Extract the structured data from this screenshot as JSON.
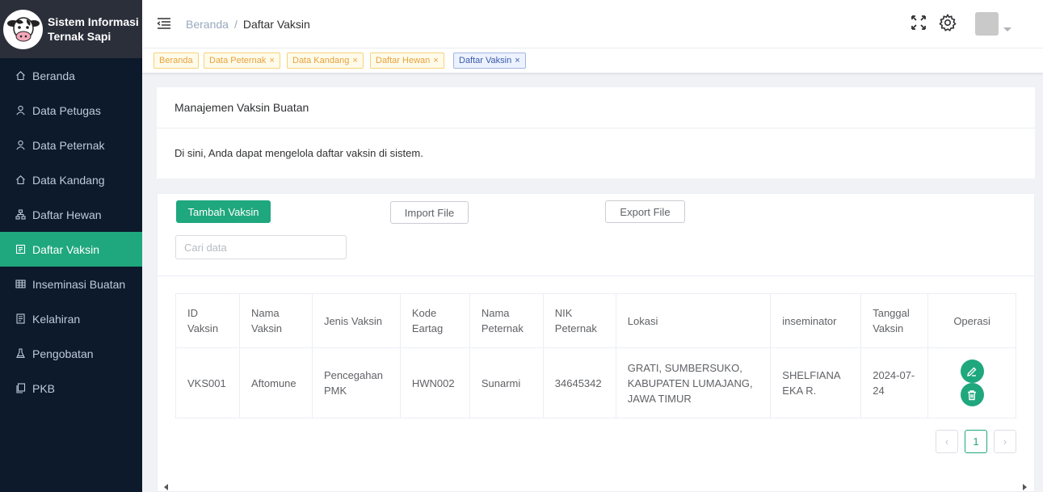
{
  "brand": {
    "line1": "Sistem Informasi",
    "line2": "Ternak Sapi"
  },
  "sidebar": {
    "items": [
      {
        "label": "Beranda",
        "icon": "home-icon"
      },
      {
        "label": "Data Petugas",
        "icon": "user-icon"
      },
      {
        "label": "Data Peternak",
        "icon": "user-icon"
      },
      {
        "label": "Data Kandang",
        "icon": "home-icon"
      },
      {
        "label": "Daftar Hewan",
        "icon": "tree-icon"
      },
      {
        "label": "Daftar Vaksin",
        "icon": "list-icon",
        "active": true
      },
      {
        "label": "Inseminasi Buatan",
        "icon": "table-icon"
      },
      {
        "label": "Kelahiran",
        "icon": "document-icon"
      },
      {
        "label": "Pengobatan",
        "icon": "flask-icon"
      },
      {
        "label": "PKB",
        "icon": "copy-icon"
      }
    ]
  },
  "header": {
    "breadcrumb": {
      "home": "Beranda",
      "separator": "/",
      "current": "Daftar Vaksin"
    }
  },
  "tags": [
    {
      "label": "Beranda",
      "closable": false
    },
    {
      "label": "Data Peternak",
      "closable": true
    },
    {
      "label": "Data Kandang",
      "closable": true
    },
    {
      "label": "Daftar Hewan",
      "closable": true
    },
    {
      "label": "Daftar Vaksin",
      "closable": true,
      "active": true
    }
  ],
  "info_card": {
    "title": "Manajemen Vaksin Buatan",
    "description": "Di sini, Anda dapat mengelola daftar vaksin di sistem."
  },
  "toolbar": {
    "add_label": "Tambah Vaksin",
    "import_label": "Import File",
    "export_label": "Export File",
    "search_placeholder": "Cari data"
  },
  "table": {
    "headers": {
      "id": [
        "ID",
        "Vaksin"
      ],
      "nama_vaksin": [
        "Nama",
        "Vaksin"
      ],
      "jenis": "Jenis Vaksin",
      "kode": [
        "Kode",
        "Eartag"
      ],
      "nama_peternak": [
        "Nama",
        "Peternak"
      ],
      "nik": [
        "NIK",
        "Peternak"
      ],
      "lokasi": "Lokasi",
      "inseminator": "inseminator",
      "tanggal": [
        "Tanggal",
        "Vaksin"
      ],
      "operasi": "Operasi"
    },
    "rows": [
      {
        "id": "VKS001",
        "nama_vaksin": "Aftomune",
        "jenis": [
          "Pencegahan",
          "PMK"
        ],
        "kode": "HWN002",
        "nama_peternak": "Sunarmi",
        "nik": "34645342",
        "lokasi": [
          "GRATI, SUMBERSUKO,",
          "KABUPATEN LUMAJANG,",
          "JAWA TIMUR"
        ],
        "inseminator": [
          "SHELFIANA",
          "EKA R."
        ],
        "tanggal": [
          "2024-07-",
          "24"
        ]
      }
    ]
  },
  "pagination": {
    "prev": "‹",
    "page": "1",
    "next": "›"
  },
  "colors": {
    "accent": "#1fa77d",
    "sidebar_bg": "#0c1a2b",
    "brand_bg": "#2b2f3a"
  }
}
